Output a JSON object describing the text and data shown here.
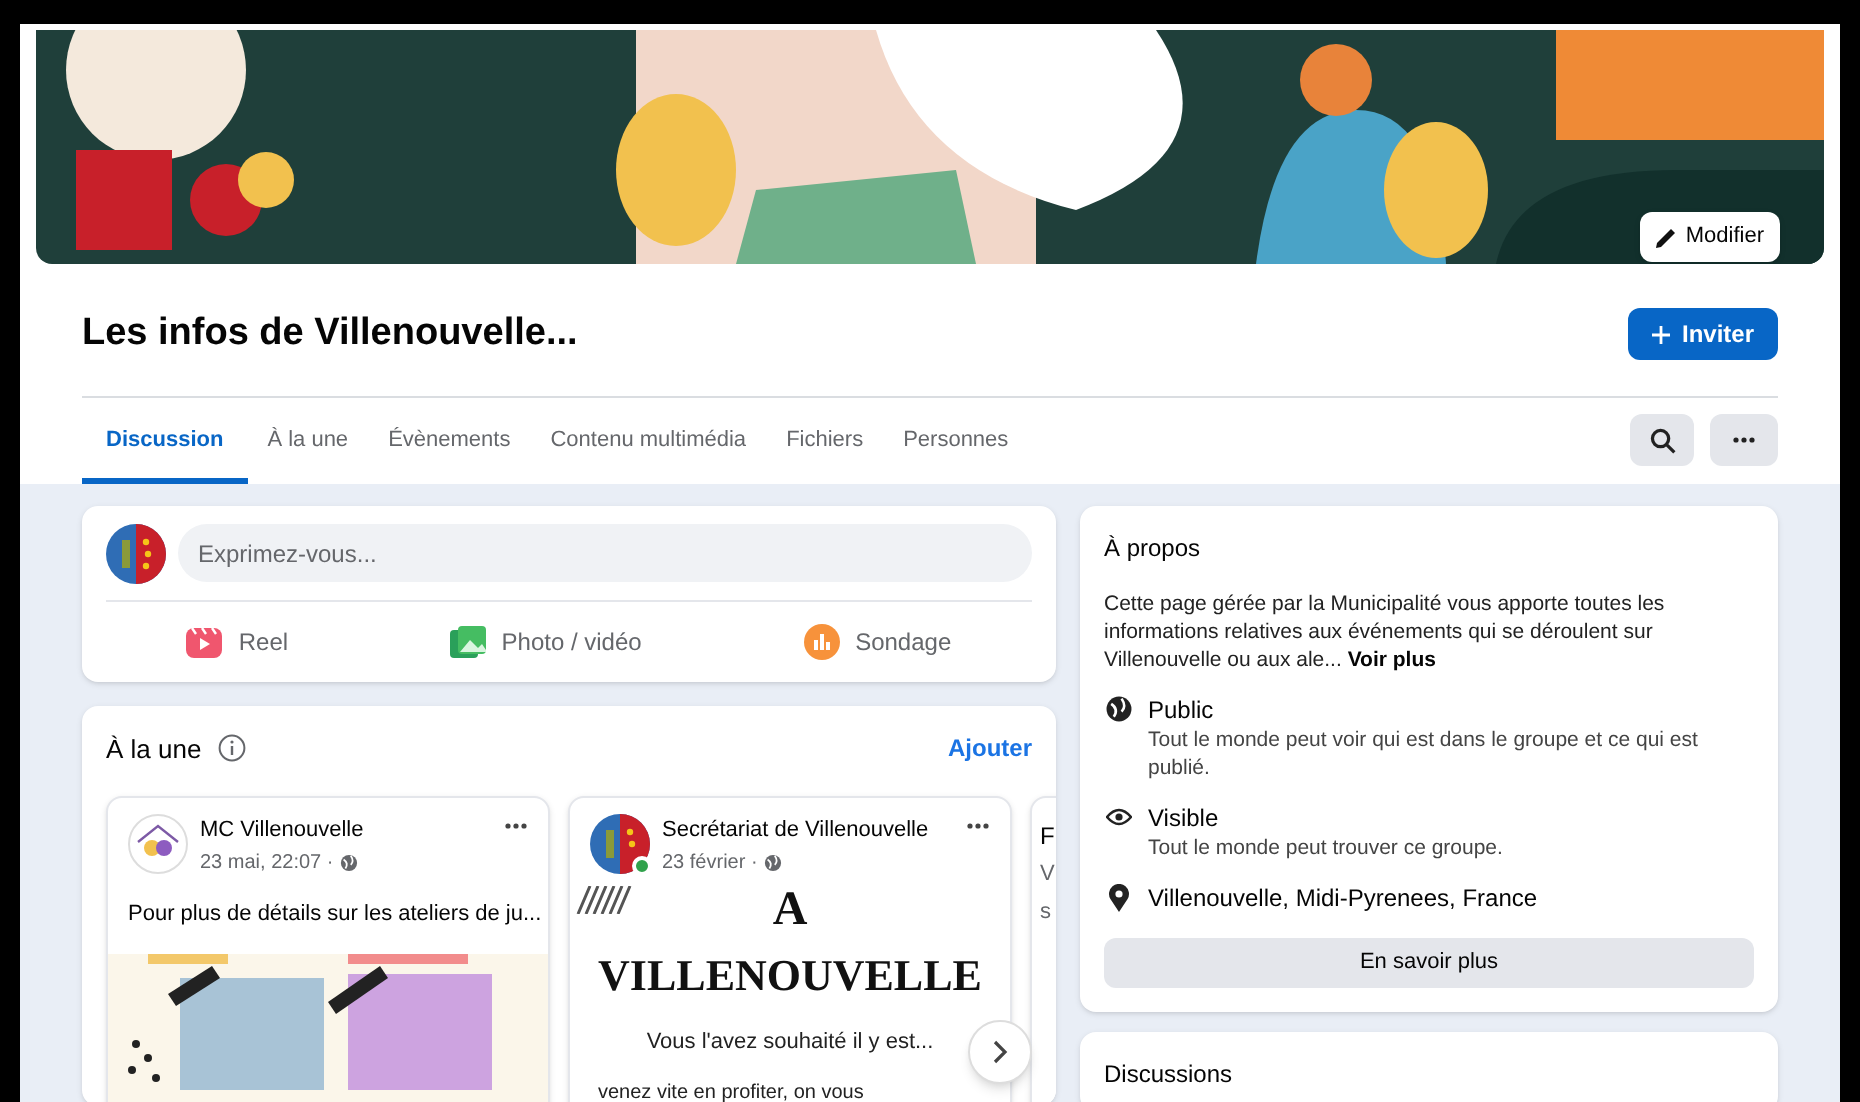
{
  "cover": {
    "kind": "picture",
    "edit_button": "Modifier"
  },
  "group": {
    "title": "Les infos de Villenouvelle...",
    "invite_button": "Inviter"
  },
  "tabs": [
    {
      "label": "Discussion",
      "selected": true
    },
    {
      "label": "À la une",
      "selected": false
    },
    {
      "label": "Évènements",
      "selected": false
    },
    {
      "label": "Contenu multimédia",
      "selected": false
    },
    {
      "label": "Fichiers",
      "selected": false
    },
    {
      "label": "Personnes",
      "selected": false
    }
  ],
  "composer": {
    "placeholder": "Exprimez-vous...",
    "actions": [
      {
        "kind": "reel",
        "label": "Reel"
      },
      {
        "label": "Photo / vidéo"
      },
      {
        "kind": "poll",
        "label": "Sondage"
      }
    ]
  },
  "featured": {
    "title": "À la une",
    "add_link": "Ajouter",
    "posts": [
      {
        "kind": "picture",
        "author": "MC Villenouvelle",
        "date": "23 mai, 22:07 ·",
        "online": false,
        "text": "Pour plus de détails sur les ateliers de ju..."
      },
      {
        "kind": "poster",
        "author": "Secrétariat de Villenouvelle",
        "date": "23 février ·",
        "online": true,
        "lines": [
          "A",
          "VILLENOUVELLE",
          "Vous l'avez souhaité il y est...",
          "venez vite en profiter, on vous"
        ]
      },
      {
        "kind": "partial",
        "author": "F",
        "date": "V",
        "text": "s"
      }
    ]
  },
  "about": {
    "title": "À propos",
    "description": "Cette page gérée par la Municipalité vous apporte toutes les informations relatives aux événements qui se déroulent sur Villenouvelle ou aux ale...",
    "more_link": "Voir plus",
    "items": [
      {
        "kind": "globe",
        "title": "Public",
        "text": "Tout le monde peut voir qui est dans le groupe et ce qui est publié."
      },
      {
        "kind": "eye",
        "title": "Visible",
        "text": "Tout le monde peut trouver ce groupe."
      },
      {
        "kind": "location",
        "title": "Villenouvelle, Midi-Pyrenees, France"
      }
    ],
    "button": "En savoir plus"
  },
  "discussions": {
    "title": "Discussions"
  }
}
